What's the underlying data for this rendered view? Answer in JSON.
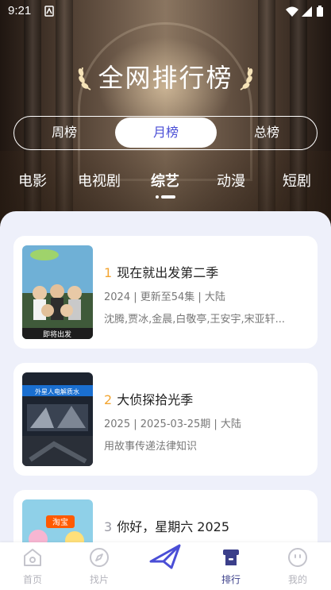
{
  "status_bar": {
    "time": "9:21"
  },
  "header": {
    "title": "全网排行榜"
  },
  "period_tabs": [
    {
      "label": "周榜",
      "active": false
    },
    {
      "label": "月榜",
      "active": true
    },
    {
      "label": "总榜",
      "active": false
    }
  ],
  "categories": [
    {
      "label": "电影",
      "active": false
    },
    {
      "label": "电视剧",
      "active": false
    },
    {
      "label": "综艺",
      "active": true
    },
    {
      "label": "动漫",
      "active": false
    },
    {
      "label": "短剧",
      "active": false
    }
  ],
  "items": [
    {
      "rank": "1",
      "title": "现在就出发第二季",
      "meta": "2024 | 更新至54集 | 大陆",
      "desc": "沈腾,贾冰,金晨,白敬亭,王安宇,宋亚轩...",
      "poster_text": "即将出发"
    },
    {
      "rank": "2",
      "title": "大侦探拾光季",
      "meta": "2025 | 2025-03-25期 | 大陆",
      "desc": "用故事传递法律知识",
      "poster_text": "外星人电解质水"
    },
    {
      "rank": "3",
      "title": "你好，星期六 2025",
      "meta": "",
      "desc": "",
      "poster_text": "淘宝"
    }
  ],
  "tabbar": [
    {
      "label": "首页",
      "icon": "home-icon",
      "active": false
    },
    {
      "label": "找片",
      "icon": "compass-icon",
      "active": false
    },
    {
      "label": "",
      "icon": "paper-plane-icon",
      "active": false
    },
    {
      "label": "排行",
      "icon": "ranking-icon",
      "active": true
    },
    {
      "label": "我的",
      "icon": "profile-icon",
      "active": false
    }
  ],
  "colors": {
    "accent": "#4a4ed6",
    "rank_gold": "#f3a531",
    "panel_bg": "#eef0fa",
    "tab_active": "#3b3f8a",
    "tab_inactive": "#b4b4bc"
  }
}
